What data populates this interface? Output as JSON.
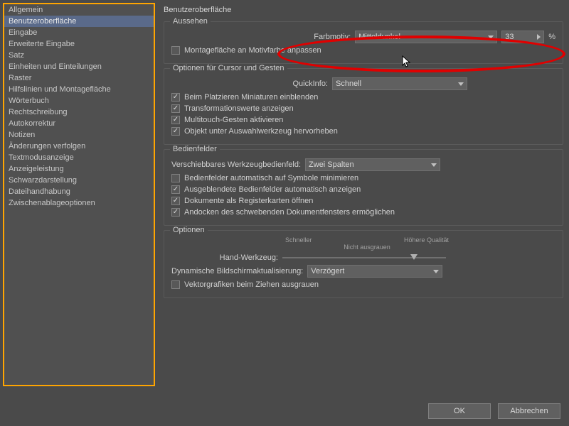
{
  "sidebar": {
    "items": [
      "Allgemein",
      "Benutzeroberfläche",
      "Eingabe",
      "Erweiterte Eingabe",
      "Satz",
      "Einheiten und Einteilungen",
      "Raster",
      "Hilfslinien und Montagefläche",
      "Wörterbuch",
      "Rechtschreibung",
      "Autokorrektur",
      "Notizen",
      "Änderungen verfolgen",
      "Textmodusanzeige",
      "Anzeigeleistung",
      "Schwarzdarstellung",
      "Dateihandhabung",
      "Zwischenablageoptionen"
    ],
    "selected": 1
  },
  "main": {
    "title": "Benutzeroberfläche"
  },
  "appearance": {
    "title": "Aussehen",
    "color_label": "Farbmotiv:",
    "color_value": "Mitteldunkel",
    "brightness_value": "33",
    "percent": "%",
    "match_label": "Montagefläche an Motivfarbe anpassen",
    "match_checked": false
  },
  "cursor": {
    "title": "Optionen für Cursor und Gesten",
    "quickinfo_label": "QuickInfo:",
    "quickinfo_value": "Schnell",
    "c1": "Beim Platzieren Miniaturen einblenden",
    "c2": "Transformationswerte anzeigen",
    "c3": "Multitouch-Gesten aktivieren",
    "c4": "Objekt unter Auswahlwerkzeug hervorheben"
  },
  "panels": {
    "title": "Bedienfelder",
    "float_label": "Verschiebbares Werkzeugbedienfeld:",
    "float_value": "Zwei Spalten",
    "p1": "Bedienfelder automatisch auf Symbole minimieren",
    "p2": "Ausgeblendete Bedienfelder automatisch anzeigen",
    "p3": "Dokumente als Registerkarten öffnen",
    "p4": "Andocken des schwebenden Dokumentfensters ermöglichen"
  },
  "options": {
    "title": "Optionen",
    "faster": "Schneller",
    "higher": "Höhere Qualität",
    "nogrey": "Nicht ausgrauen",
    "hand_label": "Hand-Werkzeug:",
    "dyn_label": "Dynamische Bildschirmaktualisierung:",
    "dyn_value": "Verzögert",
    "vec_label": "Vektorgrafiken beim Ziehen ausgrauen",
    "vec_checked": false
  },
  "footer": {
    "ok": "OK",
    "cancel": "Abbrechen"
  }
}
